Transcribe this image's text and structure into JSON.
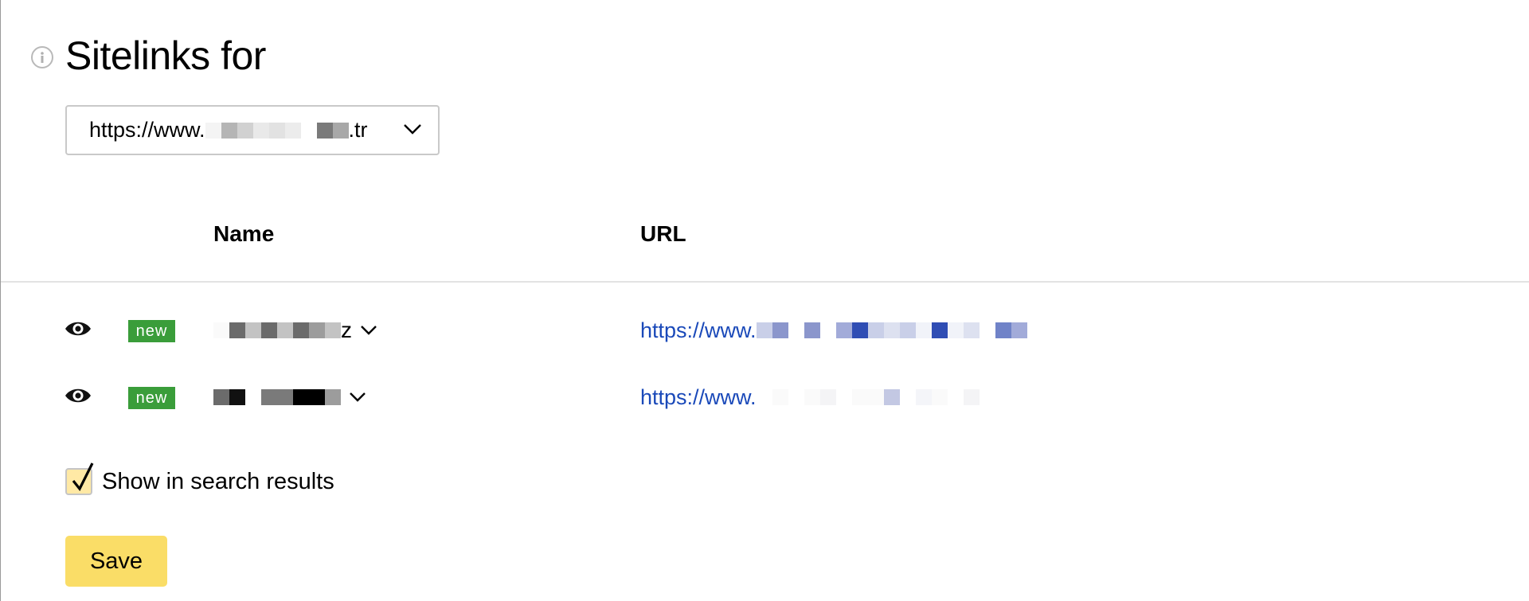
{
  "header": {
    "title": "Sitelinks for",
    "info_icon": "info-circle-icon"
  },
  "domain_select": {
    "prefix": "https://www.",
    "suffix": ".tr",
    "mosaic": [
      "#f4f4f4",
      "#b5b5b5",
      "#d1d1d1",
      "#e9e9e9",
      "#e2e2e2",
      "#ececec",
      "#ffffff",
      "#7a7a7a",
      "#a8a8a8"
    ]
  },
  "table": {
    "columns": {
      "name": "Name",
      "url": "URL"
    },
    "rows": [
      {
        "badge": "new",
        "name_suffix": "z",
        "name_mosaic": [
          "#fafafa",
          "#6b6b6b",
          "#c3c3c3",
          "#6b6b6b",
          "#c3c3c3",
          "#6b6b6b",
          "#9c9c9c",
          "#c3c3c3"
        ],
        "url_prefix": "https://www.",
        "url_mosaic": [
          "#c9cfe8",
          "#8b96cc",
          "#ffffff",
          "#8b96cc",
          "#ffffff",
          "#a2abd9",
          "#2f4db4",
          "#c9cfe8",
          "#dde1f0",
          "#c9cfe8",
          "#f1f3f9",
          "#2f4db4",
          "#f1f3f9",
          "#dde1f0",
          "#ffffff",
          "#7083c8",
          "#a2abd9"
        ]
      },
      {
        "badge": "new",
        "name_suffix": "",
        "name_mosaic": [
          "#6b6b6b",
          "#111111",
          "#ffffff",
          "#7a7a7a",
          "#7a7a7a",
          "#000000",
          "#000000",
          "#9c9c9c"
        ],
        "url_prefix": "https://www.",
        "url_mosaic": [
          "#ffffff",
          "#fafafa",
          "#ffffff",
          "#fafafa",
          "#f4f4f6",
          "#ffffff",
          "#fafafa",
          "#fafafa",
          "#c3c8e3",
          "#ffffff",
          "#f4f5f9",
          "#fafafa",
          "#ffffff",
          "#f4f4f6"
        ]
      }
    ]
  },
  "show_in_search": {
    "label": "Show in search results",
    "checked": true
  },
  "save": {
    "label": "Save"
  },
  "colors": {
    "link": "#1a49b9",
    "badge": "#3a9d3a",
    "save_bg": "#fadd67",
    "checkbox_bg": "#ffe9a5"
  }
}
